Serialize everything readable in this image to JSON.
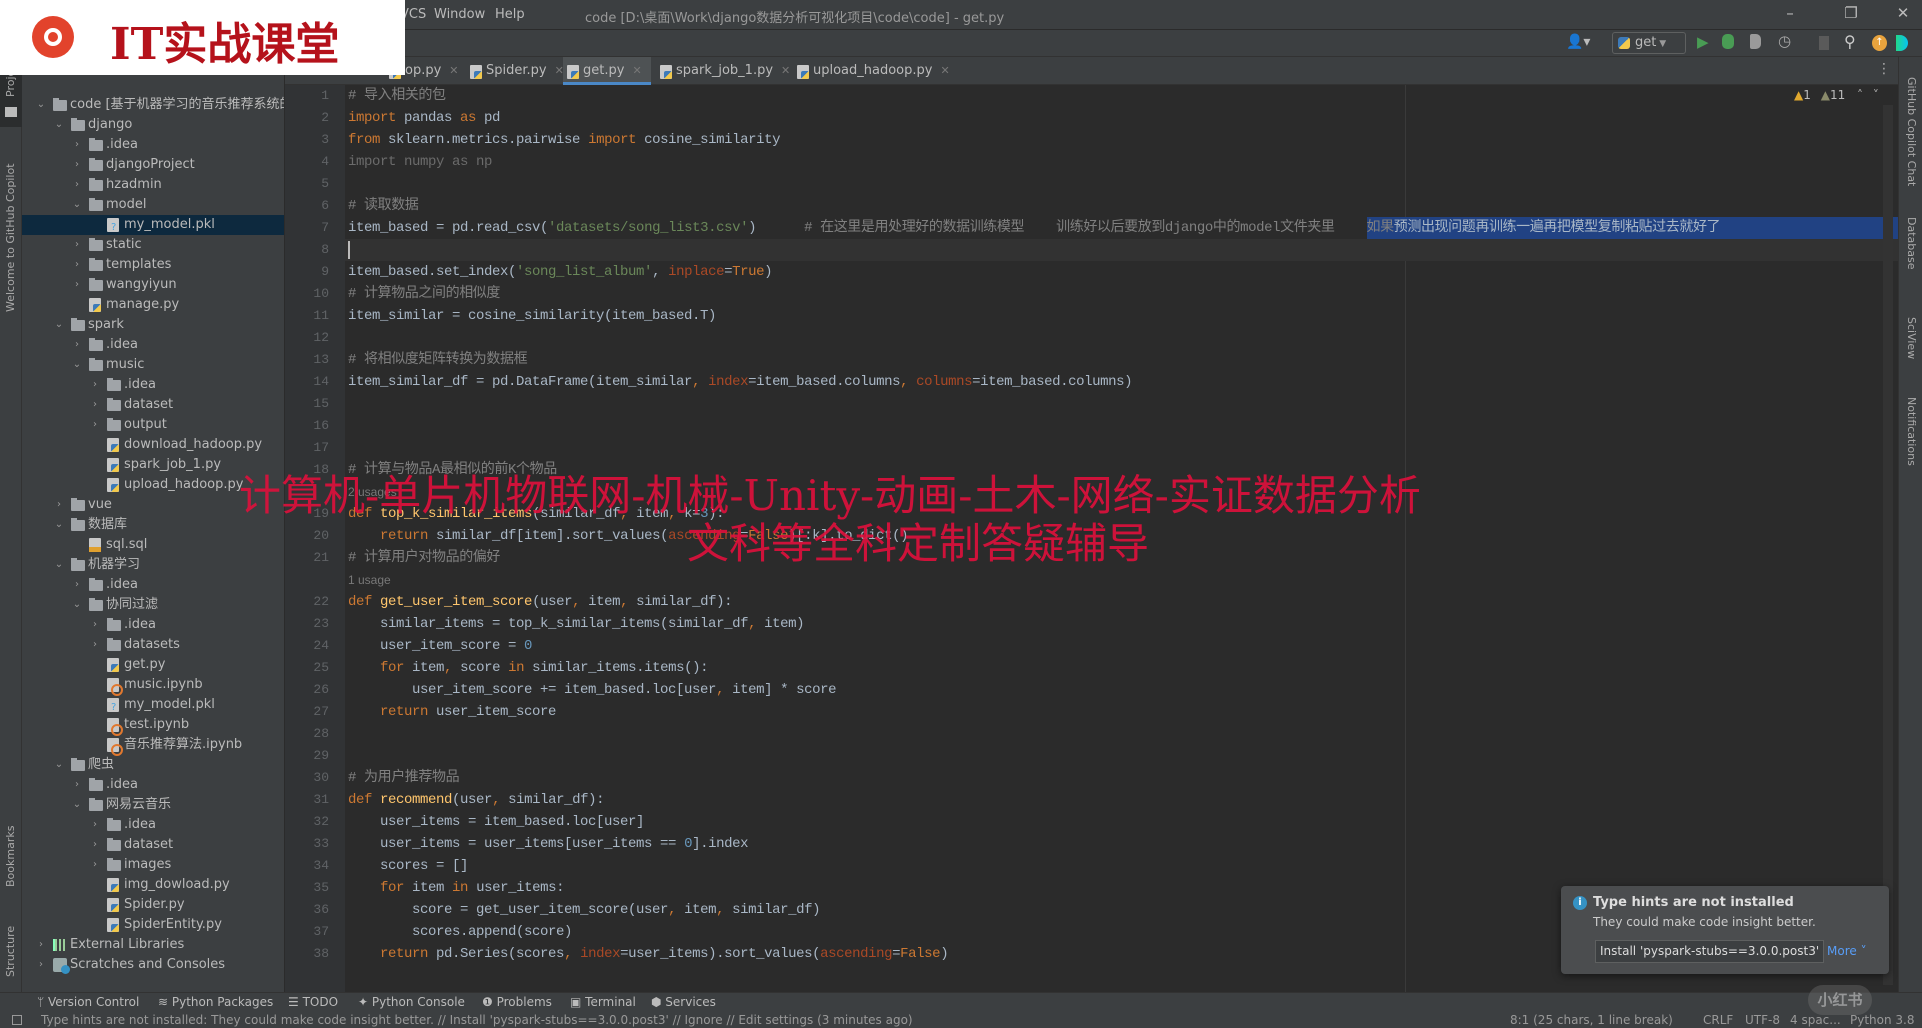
{
  "window": {
    "menu": [
      "VCS",
      "Window",
      "Help"
    ],
    "title": "code [D:\\桌面\\Work\\django数据分析可视化项目\\code\\code] - get.py",
    "controls": [
      "–",
      "❐",
      "✕"
    ]
  },
  "logo": {
    "text": "IT实战课堂"
  },
  "toolbar": {
    "run_config": "get",
    "icons": [
      "user-icon",
      "run-icon",
      "debug-icon",
      "coverage-icon",
      "profile-icon",
      "stop-icon",
      "search-icon",
      "update-icon",
      "ide-logo-icon"
    ]
  },
  "tabs": [
    {
      "label": "op.py"
    },
    {
      "label": "Spider.py"
    },
    {
      "label": "get.py",
      "active": true
    },
    {
      "label": "spark_job_1.py"
    },
    {
      "label": "upload_hadoop.py"
    }
  ],
  "left_strip": {
    "project": "Project",
    "copilot": "Welcome to GitHub Copilot",
    "bookmarks": "Bookmarks",
    "structure": "Structure"
  },
  "right_strip": {
    "copilot_chat": "GitHub Copilot Chat",
    "database": "Database",
    "sciview": "SciView",
    "notifications": "Notifications"
  },
  "inspections": {
    "warnings": "1",
    "weak_warnings": "11"
  },
  "tree": [
    {
      "d": 0,
      "a": "open",
      "i": "folder",
      "label": "code [基于机器学习的音乐推荐系统的设"
    },
    {
      "d": 1,
      "a": "open",
      "i": "folder",
      "label": "django"
    },
    {
      "d": 2,
      "a": "closed",
      "i": "folder",
      "label": ".idea"
    },
    {
      "d": 2,
      "a": "closed",
      "i": "folder",
      "label": "djangoProject"
    },
    {
      "d": 2,
      "a": "closed",
      "i": "folder",
      "label": "hzadmin"
    },
    {
      "d": 2,
      "a": "open",
      "i": "folder",
      "label": "model"
    },
    {
      "d": 3,
      "a": "",
      "i": "pkl",
      "label": "my_model.pkl",
      "selected": true
    },
    {
      "d": 2,
      "a": "closed",
      "i": "folder",
      "label": "static"
    },
    {
      "d": 2,
      "a": "closed",
      "i": "folder",
      "label": "templates"
    },
    {
      "d": 2,
      "a": "closed",
      "i": "folder",
      "label": "wangyiyun"
    },
    {
      "d": 2,
      "a": "",
      "i": "py",
      "label": "manage.py"
    },
    {
      "d": 1,
      "a": "open",
      "i": "folder",
      "label": "spark"
    },
    {
      "d": 2,
      "a": "closed",
      "i": "folder",
      "label": ".idea"
    },
    {
      "d": 2,
      "a": "open",
      "i": "folder",
      "label": "music"
    },
    {
      "d": 3,
      "a": "closed",
      "i": "folder",
      "label": ".idea"
    },
    {
      "d": 3,
      "a": "closed",
      "i": "folder",
      "label": "dataset"
    },
    {
      "d": 3,
      "a": "closed",
      "i": "folder",
      "label": "output"
    },
    {
      "d": 3,
      "a": "",
      "i": "py",
      "label": "download_hadoop.py"
    },
    {
      "d": 3,
      "a": "",
      "i": "py",
      "label": "spark_job_1.py"
    },
    {
      "d": 3,
      "a": "",
      "i": "py",
      "label": "upload_hadoop.py"
    },
    {
      "d": 1,
      "a": "closed",
      "i": "folder",
      "label": "vue"
    },
    {
      "d": 1,
      "a": "open",
      "i": "folder",
      "label": "数据库"
    },
    {
      "d": 2,
      "a": "",
      "i": "sql",
      "label": "sql.sql"
    },
    {
      "d": 1,
      "a": "open",
      "i": "folder",
      "label": "机器学习"
    },
    {
      "d": 2,
      "a": "closed",
      "i": "folder",
      "label": ".idea"
    },
    {
      "d": 2,
      "a": "open",
      "i": "folder",
      "label": "协同过滤"
    },
    {
      "d": 3,
      "a": "closed",
      "i": "folder",
      "label": ".idea"
    },
    {
      "d": 3,
      "a": "closed",
      "i": "folder",
      "label": "datasets"
    },
    {
      "d": 3,
      "a": "",
      "i": "py",
      "label": "get.py"
    },
    {
      "d": 3,
      "a": "",
      "i": "ipynb",
      "label": "music.ipynb"
    },
    {
      "d": 3,
      "a": "",
      "i": "pkl",
      "label": "my_model.pkl"
    },
    {
      "d": 3,
      "a": "",
      "i": "ipynb",
      "label": "test.ipynb"
    },
    {
      "d": 3,
      "a": "",
      "i": "ipynb",
      "label": "音乐推荐算法.ipynb"
    },
    {
      "d": 1,
      "a": "open",
      "i": "folder",
      "label": "爬虫"
    },
    {
      "d": 2,
      "a": "closed",
      "i": "folder",
      "label": ".idea"
    },
    {
      "d": 2,
      "a": "open",
      "i": "folder",
      "label": "网易云音乐"
    },
    {
      "d": 3,
      "a": "closed",
      "i": "folder",
      "label": ".idea"
    },
    {
      "d": 3,
      "a": "closed",
      "i": "folder",
      "label": "dataset"
    },
    {
      "d": 3,
      "a": "closed",
      "i": "folder",
      "label": "images"
    },
    {
      "d": 3,
      "a": "",
      "i": "py",
      "label": "img_dowload.py"
    },
    {
      "d": 3,
      "a": "",
      "i": "py",
      "label": "Spider.py"
    },
    {
      "d": 3,
      "a": "",
      "i": "py",
      "label": "SpiderEntity.py"
    },
    {
      "d": 0,
      "a": "closed",
      "i": "lib",
      "label": "External Libraries"
    },
    {
      "d": 0,
      "a": "closed",
      "i": "scratch",
      "label": "Scratches and Consoles"
    }
  ],
  "code": {
    "current_line": "8",
    "lines": [
      {
        "n": "1",
        "segs": [
          [
            "c",
            "# 导入相关的包"
          ]
        ]
      },
      {
        "n": "2",
        "segs": [
          [
            "k",
            "import"
          ],
          [
            "t",
            " pandas "
          ],
          [
            "k",
            "as"
          ],
          [
            "t",
            " pd"
          ]
        ]
      },
      {
        "n": "3",
        "segs": [
          [
            "k",
            "from"
          ],
          [
            "t",
            " sklearn.metrics.pairwise "
          ],
          [
            "k",
            "import"
          ],
          [
            "t",
            " cosine_similarity"
          ]
        ]
      },
      {
        "n": "4",
        "segs": [
          [
            "g",
            "import numpy as np"
          ]
        ]
      },
      {
        "n": "5",
        "segs": []
      },
      {
        "n": "6",
        "segs": [
          [
            "c",
            "# 读取数据"
          ]
        ]
      },
      {
        "n": "7",
        "segs": [
          [
            "t",
            "item_based = pd.read_csv("
          ],
          [
            "s",
            "'datasets/song_list3.csv'"
          ],
          [
            "t",
            ")      "
          ],
          [
            "c",
            "# 在这里是用处理好的数据训练模型    训练好以后要放到django中的model文件夹里    如果"
          ],
          [
            "sel2",
            "预测出现问题再训练一遍再把模型复制粘贴过去就好了"
          ]
        ]
      },
      {
        "n": "8",
        "segs": []
      },
      {
        "n": "9",
        "segs": [
          [
            "t",
            "item_based.set_index("
          ],
          [
            "s",
            "'song_list_album'"
          ],
          [
            "t",
            ", "
          ],
          [
            "p",
            "inplace"
          ],
          [
            "t",
            "="
          ],
          [
            "k",
            "True"
          ],
          [
            "t",
            ")"
          ]
        ]
      },
      {
        "n": "10",
        "segs": [
          [
            "c",
            "# 计算物品之间的相似度"
          ]
        ]
      },
      {
        "n": "11",
        "segs": [
          [
            "t",
            "item_similar = cosine_similarity(item_based.T)"
          ]
        ]
      },
      {
        "n": "12",
        "segs": []
      },
      {
        "n": "13",
        "segs": [
          [
            "c",
            "# 将相似度矩阵转换为数据框"
          ]
        ]
      },
      {
        "n": "14",
        "segs": [
          [
            "t",
            "item_similar_df = pd.DataFrame(item_similar"
          ],
          [
            "k",
            ", "
          ],
          [
            "p",
            "index"
          ],
          [
            "t",
            "=item_based.columns"
          ],
          [
            "k",
            ", "
          ],
          [
            "p",
            "columns"
          ],
          [
            "t",
            "=item_based.columns)"
          ]
        ]
      },
      {
        "n": "15",
        "segs": []
      },
      {
        "n": "16",
        "segs": []
      },
      {
        "n": "17",
        "segs": []
      },
      {
        "n": "18",
        "segs": [
          [
            "c",
            "# 计算与物品A最相似的前K个物品"
          ]
        ]
      },
      {
        "inlay": "2 usages"
      },
      {
        "n": "19",
        "segs": [
          [
            "k",
            "def"
          ],
          [
            "t",
            " "
          ],
          [
            "f",
            "top_k_similar_items"
          ],
          [
            "t",
            "(similar_df"
          ],
          [
            "k",
            ", "
          ],
          [
            "t",
            "item"
          ],
          [
            "k",
            ", "
          ],
          [
            "t",
            "k="
          ],
          [
            "n",
            "3"
          ],
          [
            "t",
            "):"
          ]
        ]
      },
      {
        "n": "20",
        "segs": [
          [
            "t",
            "    "
          ],
          [
            "k",
            "return"
          ],
          [
            "t",
            " similar_df[item].sort_values("
          ],
          [
            "p",
            "ascending"
          ],
          [
            "t",
            "="
          ],
          [
            "k",
            "False"
          ],
          [
            "t",
            ")[:k].to_dict()"
          ]
        ]
      },
      {
        "n": "21",
        "segs": [
          [
            "c",
            "# 计算用户对物品的偏好"
          ]
        ]
      },
      {
        "inlay": "1 usage"
      },
      {
        "n": "22",
        "segs": [
          [
            "k",
            "def"
          ],
          [
            "t",
            " "
          ],
          [
            "f",
            "get_user_item_score"
          ],
          [
            "t",
            "(user"
          ],
          [
            "k",
            ", "
          ],
          [
            "t",
            "item"
          ],
          [
            "k",
            ", "
          ],
          [
            "t",
            "similar_df):"
          ]
        ]
      },
      {
        "n": "23",
        "segs": [
          [
            "t",
            "    similar_items = top_k_similar_items(similar_df"
          ],
          [
            "k",
            ", "
          ],
          [
            "t",
            "item)"
          ]
        ]
      },
      {
        "n": "24",
        "segs": [
          [
            "t",
            "    user_item_score = "
          ],
          [
            "n",
            "0"
          ]
        ]
      },
      {
        "n": "25",
        "segs": [
          [
            "t",
            "    "
          ],
          [
            "k",
            "for"
          ],
          [
            "t",
            " item"
          ],
          [
            "k",
            ", "
          ],
          [
            "t",
            "score "
          ],
          [
            "k",
            "in"
          ],
          [
            "t",
            " similar_items.items():"
          ]
        ]
      },
      {
        "n": "26",
        "segs": [
          [
            "t",
            "        user_item_score += item_based.loc[user"
          ],
          [
            "k",
            ", "
          ],
          [
            "t",
            "item] * score"
          ]
        ]
      },
      {
        "n": "27",
        "segs": [
          [
            "t",
            "    "
          ],
          [
            "k",
            "return"
          ],
          [
            "t",
            " user_item_score"
          ]
        ]
      },
      {
        "n": "28",
        "segs": []
      },
      {
        "n": "29",
        "segs": []
      },
      {
        "n": "30",
        "segs": [
          [
            "c",
            "# 为用户推荐物品"
          ]
        ]
      },
      {
        "n": "31",
        "segs": [
          [
            "k",
            "def"
          ],
          [
            "t",
            " "
          ],
          [
            "f",
            "recommend"
          ],
          [
            "t",
            "(user"
          ],
          [
            "k",
            ", "
          ],
          [
            "t",
            "similar_df):"
          ]
        ]
      },
      {
        "n": "32",
        "segs": [
          [
            "t",
            "    user_items = item_based.loc[user]"
          ]
        ]
      },
      {
        "n": "33",
        "segs": [
          [
            "t",
            "    user_items = user_items[user_items == "
          ],
          [
            "n",
            "0"
          ],
          [
            "t",
            "].index"
          ]
        ]
      },
      {
        "n": "34",
        "segs": [
          [
            "t",
            "    scores = []"
          ]
        ]
      },
      {
        "n": "35",
        "segs": [
          [
            "t",
            "    "
          ],
          [
            "k",
            "for"
          ],
          [
            "t",
            " item "
          ],
          [
            "k",
            "in"
          ],
          [
            "t",
            " user_items:"
          ]
        ]
      },
      {
        "n": "36",
        "segs": [
          [
            "t",
            "        score = get_user_item_score(user"
          ],
          [
            "k",
            ", "
          ],
          [
            "t",
            "item"
          ],
          [
            "k",
            ", "
          ],
          [
            "t",
            "similar_df)"
          ]
        ]
      },
      {
        "n": "37",
        "segs": [
          [
            "t",
            "        scores.append(score)"
          ]
        ]
      },
      {
        "n": "38",
        "segs": [
          [
            "t",
            "    "
          ],
          [
            "k",
            "return"
          ],
          [
            "t",
            " pd.Series(scores"
          ],
          [
            "k",
            ", "
          ],
          [
            "p",
            "index"
          ],
          [
            "t",
            "=user_items).sort_values("
          ],
          [
            "p",
            "ascending"
          ],
          [
            "t",
            "="
          ],
          [
            "k",
            "False"
          ],
          [
            "t",
            ")"
          ]
        ]
      }
    ]
  },
  "overlay": {
    "line1": "计算机-单片机物联网-机械-Unity-动画-土木-网络-实证数据分析",
    "line2": "文科等全科定制答疑辅导",
    "corner": "小红书"
  },
  "notification": {
    "title": "Type hints are not installed",
    "body": "They could make code insight better.",
    "action": "Install 'pyspark-stubs==3.0.0.post3'",
    "more": "More"
  },
  "bottom_tools": [
    "Version Control",
    "Python Packages",
    "TODO",
    "Python Console",
    "Problems",
    "Terminal",
    "Services"
  ],
  "status": {
    "message": "Type hints are not installed: They could make code insight better. // Install 'pyspark-stubs==3.0.0.post3' // Ignore // Edit settings (3 minutes ago)",
    "position": "8:1 (25 chars, 1 line break)",
    "line_sep": "CRLF",
    "encoding": "UTF-8",
    "indent": "4 spac...",
    "interpreter": "Python 3.8"
  }
}
